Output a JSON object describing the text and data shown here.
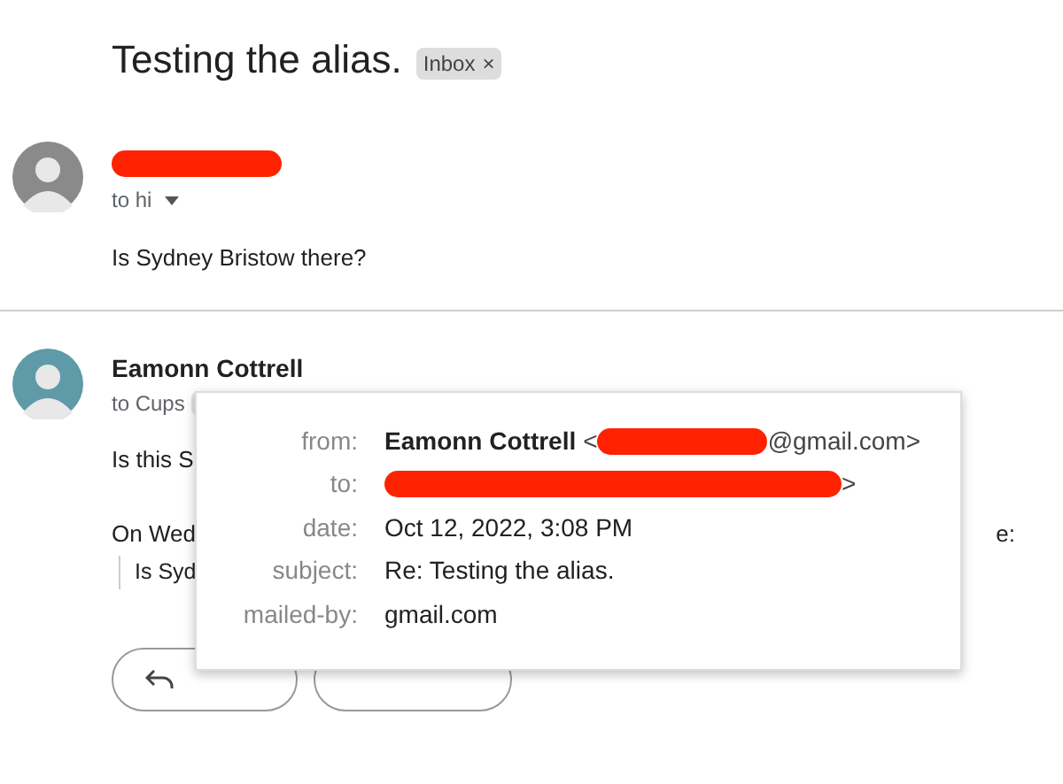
{
  "thread": {
    "subject": "Testing the alias.",
    "label": {
      "text": "Inbox",
      "close": "×"
    }
  },
  "messages": [
    {
      "sender": {
        "kind": "redacted"
      },
      "recipient": "to hi",
      "body": "Is Sydney Bristow there?"
    },
    {
      "sender": {
        "kind": "text",
        "text": "Eamonn Cottrell"
      },
      "recipient": "to Cups",
      "body": "Is this S",
      "quote_header_start": "On Wed",
      "quote_header_end": "e:",
      "quote": "Is Syd"
    }
  ],
  "details_popup": {
    "rows": [
      {
        "label": "from:",
        "parts": [
          {
            "kind": "bold",
            "text": "Eamonn Cottrell"
          },
          {
            "kind": "text",
            "text": "<"
          },
          {
            "kind": "redacted"
          },
          {
            "kind": "text",
            "text": "@gmail.com>"
          }
        ]
      },
      {
        "label": "to:",
        "parts": [
          {
            "kind": "redacted"
          },
          {
            "kind": "text",
            "text": ">"
          }
        ]
      },
      {
        "label": "date:",
        "parts": [
          {
            "kind": "text",
            "text": "Oct 12, 2022, 3:08 PM"
          }
        ]
      },
      {
        "label": "subject:",
        "parts": [
          {
            "kind": "text",
            "text": "Re: Testing the alias."
          }
        ]
      },
      {
        "label": "mailed-by:",
        "parts": [
          {
            "kind": "text",
            "text": "gmail.com"
          }
        ]
      }
    ]
  }
}
